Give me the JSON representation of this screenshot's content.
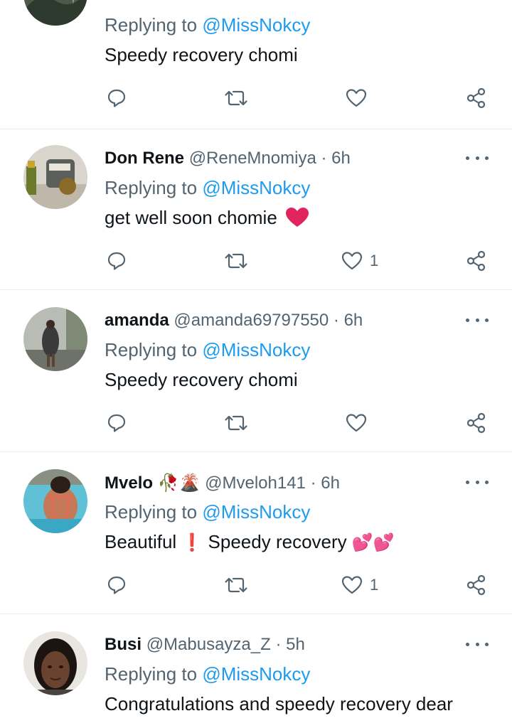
{
  "replies": [
    {
      "name": "",
      "handle": "",
      "time": "",
      "replying_label": "Replying to",
      "replying_to": "@MissNokcy",
      "text": "Speedy recovery chomi",
      "likes": "",
      "avatar": "plant-photo"
    },
    {
      "name": "Don Rene",
      "handle": "@ReneMnomiya",
      "time": "6h",
      "replying_label": "Replying to",
      "replying_to": "@MissNokcy",
      "text": "get well soon chomie",
      "text_emoji": "❤",
      "likes": "1",
      "avatar": "kitchen-photo"
    },
    {
      "name": "amanda",
      "handle": "@amanda69797550",
      "time": "6h",
      "replying_label": "Replying to",
      "replying_to": "@MissNokcy",
      "text": "Speedy recovery chomi",
      "likes": "",
      "avatar": "person-outdoor-photo"
    },
    {
      "name": "Mvelo",
      "name_emoji": "🥀🌋",
      "handle": "@Mveloh141",
      "time": "6h",
      "replying_label": "Replying to",
      "replying_to": "@MissNokcy",
      "text_before": "Beautiful",
      "text_mid_emoji": "❗",
      "text_after": "Speedy recovery",
      "text_end_emoji": "💕💕",
      "likes": "1",
      "avatar": "pool-photo"
    },
    {
      "name": "Busi",
      "handle": "@Mabusayza_Z",
      "time": "5h",
      "replying_label": "Replying to",
      "replying_to": "@MissNokcy",
      "text": "Congratulations and speedy recovery dear",
      "likes": "",
      "avatar": "selfie-photo"
    }
  ],
  "colors": {
    "text": "#0f1419",
    "muted": "#536471",
    "mention": "#1d9bf0",
    "divider": "#e6ecf0",
    "heart": "#e0245e"
  }
}
